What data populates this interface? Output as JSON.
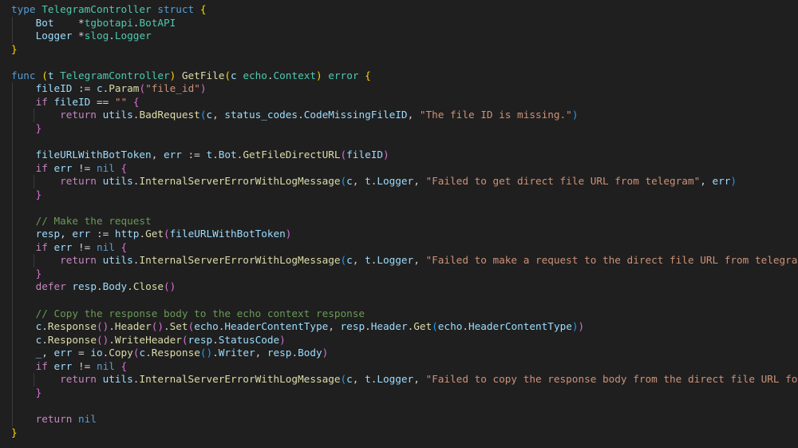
{
  "colors": {
    "background": "#1f1f1f",
    "plain": "#cccccc",
    "keyword": "#569cd6",
    "control": "#c586c0",
    "type": "#4ec9b0",
    "function": "#dcdcaa",
    "variable": "#9cdcfe",
    "string": "#ce9178",
    "comment": "#6a9955",
    "punct": "#d4d4d4",
    "bracket1": "#ffd700",
    "bracket2": "#da70d6",
    "bracket3": "#179fff",
    "guide": "#3b3b3b"
  },
  "code_lines": [
    [
      [
        "type ",
        "keyword"
      ],
      [
        "TelegramController",
        "type"
      ],
      [
        " ",
        "plain"
      ],
      [
        "struct",
        "keyword"
      ],
      [
        " ",
        "plain"
      ],
      [
        "{",
        "bracket1"
      ]
    ],
    [
      [
        "    ",
        "plain"
      ],
      [
        "Bot",
        "variable"
      ],
      [
        "    ",
        "plain"
      ],
      [
        "*",
        "punct"
      ],
      [
        "tgbotapi",
        "type"
      ],
      [
        ".",
        "punct"
      ],
      [
        "BotAPI",
        "type"
      ]
    ],
    [
      [
        "    ",
        "plain"
      ],
      [
        "Logger",
        "variable"
      ],
      [
        " ",
        "plain"
      ],
      [
        "*",
        "punct"
      ],
      [
        "slog",
        "type"
      ],
      [
        ".",
        "punct"
      ],
      [
        "Logger",
        "type"
      ]
    ],
    [
      [
        "}",
        "bracket1"
      ]
    ],
    [],
    [
      [
        "func ",
        "keyword"
      ],
      [
        "(",
        "bracket1"
      ],
      [
        "t ",
        "variable"
      ],
      [
        "TelegramController",
        "type"
      ],
      [
        ")",
        "bracket1"
      ],
      [
        " ",
        "plain"
      ],
      [
        "GetFile",
        "function"
      ],
      [
        "(",
        "bracket1"
      ],
      [
        "c ",
        "variable"
      ],
      [
        "echo",
        "type"
      ],
      [
        ".",
        "punct"
      ],
      [
        "Context",
        "type"
      ],
      [
        ")",
        "bracket1"
      ],
      [
        " ",
        "plain"
      ],
      [
        "error",
        "type"
      ],
      [
        " ",
        "plain"
      ],
      [
        "{",
        "bracket1"
      ]
    ],
    [
      [
        "    ",
        "plain"
      ],
      [
        "fileID",
        "variable"
      ],
      [
        " := ",
        "punct"
      ],
      [
        "c",
        "variable"
      ],
      [
        ".",
        "punct"
      ],
      [
        "Param",
        "function"
      ],
      [
        "(",
        "bracket2"
      ],
      [
        "\"file_id\"",
        "string"
      ],
      [
        ")",
        "bracket2"
      ]
    ],
    [
      [
        "    ",
        "plain"
      ],
      [
        "if",
        "control"
      ],
      [
        " ",
        "plain"
      ],
      [
        "fileID",
        "variable"
      ],
      [
        " == ",
        "punct"
      ],
      [
        "\"\"",
        "string"
      ],
      [
        " ",
        "plain"
      ],
      [
        "{",
        "bracket2"
      ]
    ],
    [
      [
        "        ",
        "plain"
      ],
      [
        "return",
        "control"
      ],
      [
        " ",
        "plain"
      ],
      [
        "utils",
        "variable"
      ],
      [
        ".",
        "punct"
      ],
      [
        "BadRequest",
        "function"
      ],
      [
        "(",
        "bracket3"
      ],
      [
        "c",
        "variable"
      ],
      [
        ", ",
        "punct"
      ],
      [
        "status_codes",
        "variable"
      ],
      [
        ".",
        "punct"
      ],
      [
        "CodeMissingFileID",
        "variable"
      ],
      [
        ", ",
        "punct"
      ],
      [
        "\"The file ID is missing.\"",
        "string"
      ],
      [
        ")",
        "bracket3"
      ]
    ],
    [
      [
        "    ",
        "plain"
      ],
      [
        "}",
        "bracket2"
      ]
    ],
    [],
    [
      [
        "    ",
        "plain"
      ],
      [
        "fileURLWithBotToken",
        "variable"
      ],
      [
        ", ",
        "punct"
      ],
      [
        "err",
        "variable"
      ],
      [
        " := ",
        "punct"
      ],
      [
        "t",
        "variable"
      ],
      [
        ".",
        "punct"
      ],
      [
        "Bot",
        "variable"
      ],
      [
        ".",
        "punct"
      ],
      [
        "GetFileDirectURL",
        "function"
      ],
      [
        "(",
        "bracket2"
      ],
      [
        "fileID",
        "variable"
      ],
      [
        ")",
        "bracket2"
      ]
    ],
    [
      [
        "    ",
        "plain"
      ],
      [
        "if",
        "control"
      ],
      [
        " ",
        "plain"
      ],
      [
        "err",
        "variable"
      ],
      [
        " != ",
        "punct"
      ],
      [
        "nil",
        "keyword"
      ],
      [
        " ",
        "plain"
      ],
      [
        "{",
        "bracket2"
      ]
    ],
    [
      [
        "        ",
        "plain"
      ],
      [
        "return",
        "control"
      ],
      [
        " ",
        "plain"
      ],
      [
        "utils",
        "variable"
      ],
      [
        ".",
        "punct"
      ],
      [
        "InternalServerErrorWithLogMessage",
        "function"
      ],
      [
        "(",
        "bracket3"
      ],
      [
        "c",
        "variable"
      ],
      [
        ", ",
        "punct"
      ],
      [
        "t",
        "variable"
      ],
      [
        ".",
        "punct"
      ],
      [
        "Logger",
        "variable"
      ],
      [
        ", ",
        "punct"
      ],
      [
        "\"Failed to get direct file URL from telegram\"",
        "string"
      ],
      [
        ", ",
        "punct"
      ],
      [
        "err",
        "variable"
      ],
      [
        ")",
        "bracket3"
      ]
    ],
    [
      [
        "    ",
        "plain"
      ],
      [
        "}",
        "bracket2"
      ]
    ],
    [],
    [
      [
        "    ",
        "plain"
      ],
      [
        "// Make the request",
        "comment"
      ]
    ],
    [
      [
        "    ",
        "plain"
      ],
      [
        "resp",
        "variable"
      ],
      [
        ", ",
        "punct"
      ],
      [
        "err",
        "variable"
      ],
      [
        " := ",
        "punct"
      ],
      [
        "http",
        "variable"
      ],
      [
        ".",
        "punct"
      ],
      [
        "Get",
        "function"
      ],
      [
        "(",
        "bracket2"
      ],
      [
        "fileURLWithBotToken",
        "variable"
      ],
      [
        ")",
        "bracket2"
      ]
    ],
    [
      [
        "    ",
        "plain"
      ],
      [
        "if",
        "control"
      ],
      [
        " ",
        "plain"
      ],
      [
        "err",
        "variable"
      ],
      [
        " != ",
        "punct"
      ],
      [
        "nil",
        "keyword"
      ],
      [
        " ",
        "plain"
      ],
      [
        "{",
        "bracket2"
      ]
    ],
    [
      [
        "        ",
        "plain"
      ],
      [
        "return",
        "control"
      ],
      [
        " ",
        "plain"
      ],
      [
        "utils",
        "variable"
      ],
      [
        ".",
        "punct"
      ],
      [
        "InternalServerErrorWithLogMessage",
        "function"
      ],
      [
        "(",
        "bracket3"
      ],
      [
        "c",
        "variable"
      ],
      [
        ", ",
        "punct"
      ],
      [
        "t",
        "variable"
      ],
      [
        ".",
        "punct"
      ],
      [
        "Logger",
        "variable"
      ],
      [
        ", ",
        "punct"
      ],
      [
        "\"Failed to make a request to the direct file URL from telegram\"",
        "string"
      ],
      [
        ", ",
        "punct"
      ],
      [
        "err",
        "variable"
      ],
      [
        ")",
        "bracket3"
      ]
    ],
    [
      [
        "    ",
        "plain"
      ],
      [
        "}",
        "bracket2"
      ]
    ],
    [
      [
        "    ",
        "plain"
      ],
      [
        "defer",
        "control"
      ],
      [
        " ",
        "plain"
      ],
      [
        "resp",
        "variable"
      ],
      [
        ".",
        "punct"
      ],
      [
        "Body",
        "variable"
      ],
      [
        ".",
        "punct"
      ],
      [
        "Close",
        "function"
      ],
      [
        "()",
        "bracket2"
      ]
    ],
    [],
    [
      [
        "    ",
        "plain"
      ],
      [
        "// Copy the response body to the echo context response",
        "comment"
      ]
    ],
    [
      [
        "    ",
        "plain"
      ],
      [
        "c",
        "variable"
      ],
      [
        ".",
        "punct"
      ],
      [
        "Response",
        "function"
      ],
      [
        "()",
        "bracket2"
      ],
      [
        ".",
        "punct"
      ],
      [
        "Header",
        "function"
      ],
      [
        "()",
        "bracket2"
      ],
      [
        ".",
        "punct"
      ],
      [
        "Set",
        "function"
      ],
      [
        "(",
        "bracket2"
      ],
      [
        "echo",
        "variable"
      ],
      [
        ".",
        "punct"
      ],
      [
        "HeaderContentType",
        "variable"
      ],
      [
        ", ",
        "punct"
      ],
      [
        "resp",
        "variable"
      ],
      [
        ".",
        "punct"
      ],
      [
        "Header",
        "variable"
      ],
      [
        ".",
        "punct"
      ],
      [
        "Get",
        "function"
      ],
      [
        "(",
        "bracket3"
      ],
      [
        "echo",
        "variable"
      ],
      [
        ".",
        "punct"
      ],
      [
        "HeaderContentType",
        "variable"
      ],
      [
        ")",
        "bracket3"
      ],
      [
        ")",
        "bracket2"
      ]
    ],
    [
      [
        "    ",
        "plain"
      ],
      [
        "c",
        "variable"
      ],
      [
        ".",
        "punct"
      ],
      [
        "Response",
        "function"
      ],
      [
        "()",
        "bracket2"
      ],
      [
        ".",
        "punct"
      ],
      [
        "WriteHeader",
        "function"
      ],
      [
        "(",
        "bracket2"
      ],
      [
        "resp",
        "variable"
      ],
      [
        ".",
        "punct"
      ],
      [
        "StatusCode",
        "variable"
      ],
      [
        ")",
        "bracket2"
      ]
    ],
    [
      [
        "    ",
        "plain"
      ],
      [
        "_",
        "variable"
      ],
      [
        ", ",
        "punct"
      ],
      [
        "err",
        "variable"
      ],
      [
        " = ",
        "punct"
      ],
      [
        "io",
        "variable"
      ],
      [
        ".",
        "punct"
      ],
      [
        "Copy",
        "function"
      ],
      [
        "(",
        "bracket2"
      ],
      [
        "c",
        "variable"
      ],
      [
        ".",
        "punct"
      ],
      [
        "Response",
        "function"
      ],
      [
        "()",
        "bracket3"
      ],
      [
        ".",
        "punct"
      ],
      [
        "Writer",
        "variable"
      ],
      [
        ", ",
        "punct"
      ],
      [
        "resp",
        "variable"
      ],
      [
        ".",
        "punct"
      ],
      [
        "Body",
        "variable"
      ],
      [
        ")",
        "bracket2"
      ]
    ],
    [
      [
        "    ",
        "plain"
      ],
      [
        "if",
        "control"
      ],
      [
        " ",
        "plain"
      ],
      [
        "err",
        "variable"
      ],
      [
        " != ",
        "punct"
      ],
      [
        "nil",
        "keyword"
      ],
      [
        " ",
        "plain"
      ],
      [
        "{",
        "bracket2"
      ]
    ],
    [
      [
        "        ",
        "plain"
      ],
      [
        "return",
        "control"
      ],
      [
        " ",
        "plain"
      ],
      [
        "utils",
        "variable"
      ],
      [
        ".",
        "punct"
      ],
      [
        "InternalServerErrorWithLogMessage",
        "function"
      ],
      [
        "(",
        "bracket3"
      ],
      [
        "c",
        "variable"
      ],
      [
        ", ",
        "punct"
      ],
      [
        "t",
        "variable"
      ],
      [
        ".",
        "punct"
      ],
      [
        "Logger",
        "variable"
      ],
      [
        ", ",
        "punct"
      ],
      [
        "\"Failed to copy the response body from the direct file URL for telegram\"",
        "string"
      ],
      [
        ", ",
        "punct"
      ],
      [
        "err",
        "variable"
      ],
      [
        ")",
        "bracket3"
      ]
    ],
    [
      [
        "    ",
        "plain"
      ],
      [
        "}",
        "bracket2"
      ]
    ],
    [],
    [
      [
        "    ",
        "plain"
      ],
      [
        "return",
        "control"
      ],
      [
        " ",
        "plain"
      ],
      [
        "nil",
        "keyword"
      ]
    ],
    [
      [
        "}",
        "bracket1"
      ]
    ]
  ]
}
